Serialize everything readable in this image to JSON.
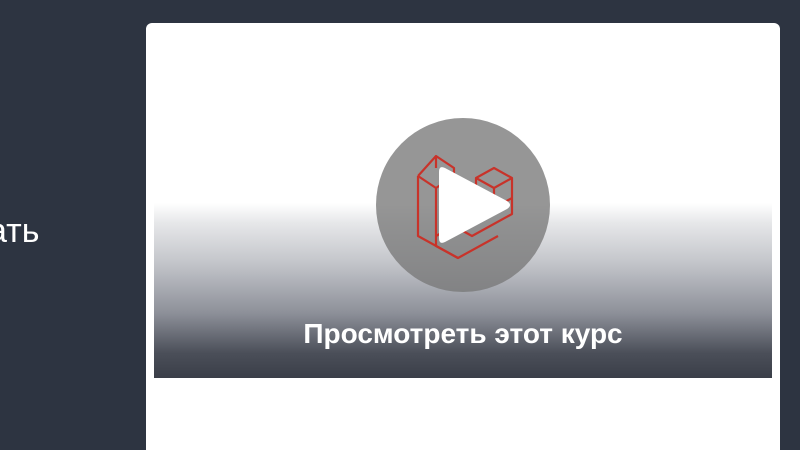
{
  "hero": {
    "partial_heading": "ать"
  },
  "course_card": {
    "preview_label": "Просмотреть этот курс",
    "logo_icon": "laravel-logo-icon",
    "play_icon": "play-icon",
    "colors": {
      "background": "#2d3441",
      "card": "#ffffff",
      "logo_stroke": "#c8332a",
      "play_circle": "#787878"
    }
  }
}
